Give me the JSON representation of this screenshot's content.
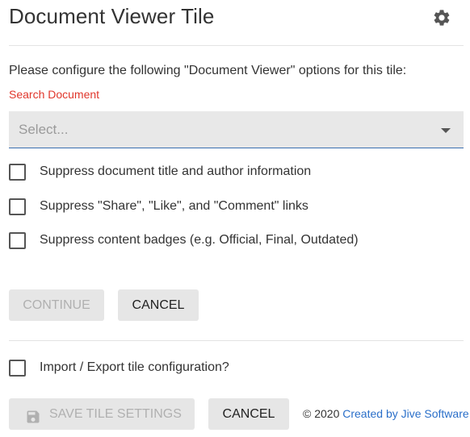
{
  "header": {
    "title": "Document Viewer Tile",
    "settings_icon": "gear-icon"
  },
  "intro": "Please configure the following \"Document Viewer\" options for this tile:",
  "search": {
    "label": "Search Document",
    "placeholder": "Select...",
    "value": ""
  },
  "options": [
    {
      "label": "Suppress document title and author information",
      "checked": false
    },
    {
      "label": "Suppress \"Share\", \"Like\", and \"Comment\" links",
      "checked": false
    },
    {
      "label": "Suppress content badges (e.g. Official, Final, Outdated)",
      "checked": false
    }
  ],
  "actions": {
    "continue_label": "CONTINUE",
    "continue_enabled": false,
    "cancel_label": "CANCEL"
  },
  "import_export": {
    "label": "Import / Export tile configuration?",
    "checked": false
  },
  "footer": {
    "save_label": "SAVE TILE SETTINGS",
    "save_icon": "floppy-disk-icon",
    "save_enabled": false,
    "cancel_label": "CANCEL",
    "copyright": "© 2020",
    "credit_link": "Created by Jive Software"
  },
  "colors": {
    "label_red": "#e0362b",
    "link_blue": "#2a6fc9",
    "select_underline": "#3a6fb0",
    "button_bg": "#e6e6e6"
  }
}
